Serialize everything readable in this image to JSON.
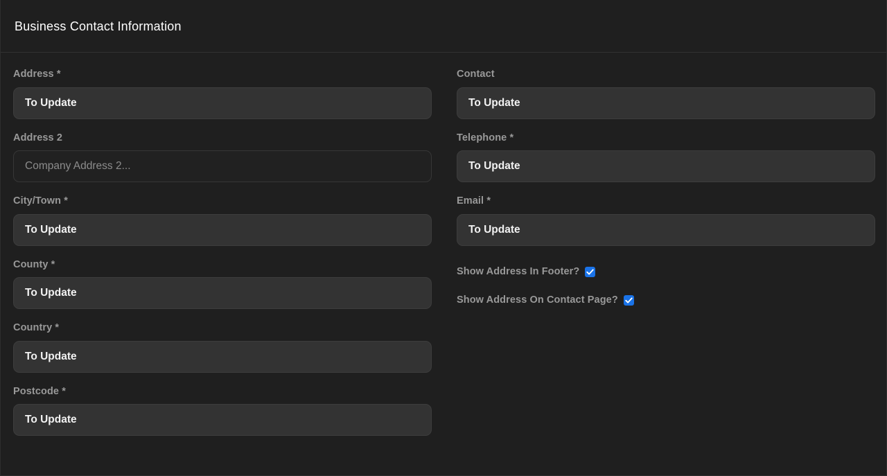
{
  "panel": {
    "title": "Business Contact Information"
  },
  "accent": {
    "checkbox_blue": "#1a73e8",
    "label_gray": "#999999",
    "input_bg": "#333333",
    "empty_input_bg": "#212121",
    "page_bg": "#1f1f1f"
  },
  "left_column": {
    "fields": [
      {
        "label": "Address *",
        "value": "To Update",
        "placeholder": ""
      },
      {
        "label": "Address 2",
        "value": "",
        "placeholder": "Company Address 2..."
      },
      {
        "label": "City/Town *",
        "value": "To Update",
        "placeholder": ""
      },
      {
        "label": "County *",
        "value": "To Update",
        "placeholder": ""
      },
      {
        "label": "Country *",
        "value": "To Update",
        "placeholder": ""
      },
      {
        "label": "Postcode *",
        "value": "To Update",
        "placeholder": ""
      }
    ]
  },
  "right_column": {
    "fields": [
      {
        "label": "Contact",
        "value": "To Update",
        "placeholder": ""
      },
      {
        "label": "Telephone *",
        "value": "To Update",
        "placeholder": ""
      },
      {
        "label": "Email *",
        "value": "To Update",
        "placeholder": ""
      }
    ],
    "checkboxes": [
      {
        "label": "Show Address In Footer?",
        "checked": true
      },
      {
        "label": "Show Address On Contact Page?",
        "checked": true
      }
    ]
  }
}
